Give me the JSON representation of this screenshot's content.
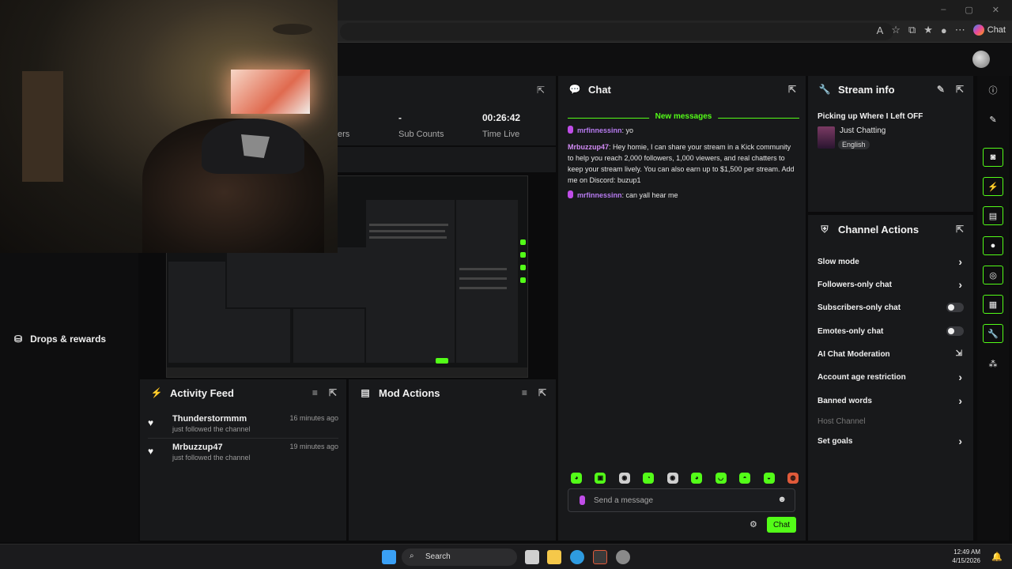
{
  "browser": {
    "copilot_label": "Chat",
    "window_controls": [
      "–",
      "▢",
      "✕"
    ],
    "toolbar_icons": [
      "read-aloud-icon",
      "favorite-star-icon",
      "extensions-icon",
      "favorites-icon",
      "profile-icon",
      "more-icon"
    ]
  },
  "sidebar": {
    "drops_label": "Drops & rewards"
  },
  "stats": {
    "followers_label": "ers",
    "sub_counts_value": "-",
    "sub_counts_label": "Sub Counts",
    "time_live_value": "00:26:42",
    "time_live_label": "Time Live"
  },
  "activity_feed": {
    "title": "Activity Feed",
    "items": [
      {
        "name": "Thunderstormmm",
        "desc": "just followed the channel",
        "time": "16 minutes ago"
      },
      {
        "name": "Mrbuzzup47",
        "desc": "just followed the channel",
        "time": "19 minutes ago"
      }
    ]
  },
  "mod_actions": {
    "title": "Mod Actions"
  },
  "chat": {
    "title": "Chat",
    "new_messages_label": "New messages",
    "messages": [
      {
        "user": "mrfinnessinn",
        "text": ": yo",
        "color": "#b77bf0"
      },
      {
        "user": "Mrbuzzup47",
        "text": ": Hey homie, I can share your stream in a Kick community to help you reach 2,000 followers, 1,000 viewers, and real chatters to keep your stream lively. You can also earn up to $1,500 per stream. Add me on Discord: buzup1",
        "color": "#d28bf5"
      },
      {
        "user": "mrfinnessinn",
        "text": ": can yall hear me",
        "color": "#b77bf0"
      }
    ],
    "input_placeholder": "Send a message",
    "send_label": "Chat",
    "emotes": [
      "emote-1",
      "emote-2",
      "emote-3",
      "emote-4",
      "emote-5",
      "emote-6",
      "emote-7",
      "emote-8",
      "emote-9",
      "emote-10"
    ]
  },
  "stream_info": {
    "title": "Stream info",
    "stream_title": "Picking up Where I Left OFF",
    "category": "Just Chatting",
    "language": "English"
  },
  "channel_actions": {
    "title": "Channel Actions",
    "items": [
      {
        "label": "Slow mode",
        "control": "chevron"
      },
      {
        "label": "Followers-only chat",
        "control": "chevron"
      },
      {
        "label": "Subscribers-only chat",
        "control": "toggle"
      },
      {
        "label": "Emotes-only chat",
        "control": "toggle"
      },
      {
        "label": "AI Chat Moderation",
        "control": "external"
      },
      {
        "label": "Account age restriction",
        "control": "chevron"
      },
      {
        "label": "Banned words",
        "control": "chevron"
      },
      {
        "label": "Host Channel",
        "control": "none"
      },
      {
        "label": "Set goals",
        "control": "chevron"
      }
    ]
  },
  "taskbar": {
    "search_label": "Search",
    "time": "12:49 AM",
    "date": "4/15/2026"
  },
  "colors": {
    "accent": "#53fc18",
    "panel": "#18191b",
    "background": "#0b0b0c"
  }
}
